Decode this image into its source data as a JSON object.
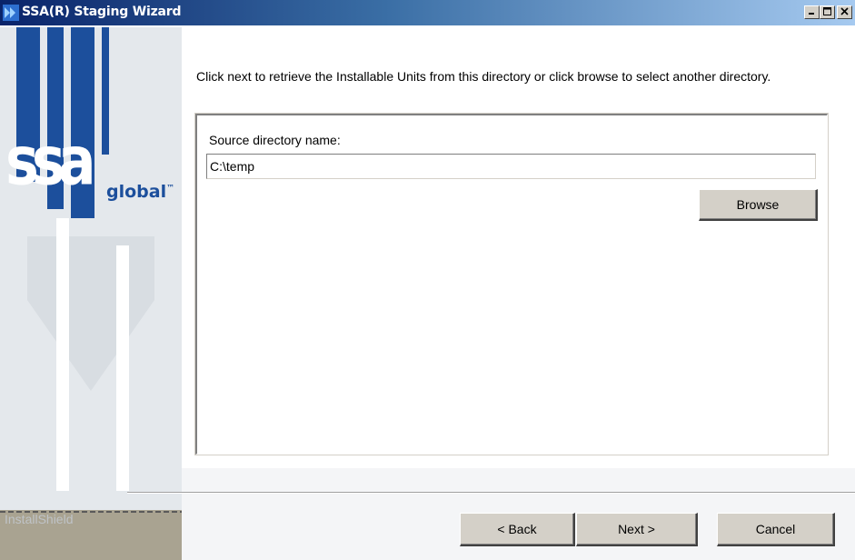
{
  "window": {
    "title": "SSA(R) Staging Wizard",
    "controls": {
      "minimize": "_",
      "maximize": "□",
      "close": "X"
    }
  },
  "banner": {
    "logo_text": "ssa",
    "logo_suffix": "global",
    "trademark": "™",
    "installer_brand": "InstallShield"
  },
  "main": {
    "instruction": "Click next to retrieve the Installable Units from this directory or click browse to select another directory.",
    "source_label": "Source directory name:",
    "source_value": "C:\\temp",
    "browse_label": "Browse"
  },
  "footer": {
    "back_label": "< Back",
    "next_label": "Next >",
    "cancel_label": "Cancel"
  },
  "colors": {
    "titlebar_start": "#0a246a",
    "titlebar_end": "#a6caf0",
    "button_face": "#d4d0c8",
    "logo_blue": "#1c4f9c"
  }
}
